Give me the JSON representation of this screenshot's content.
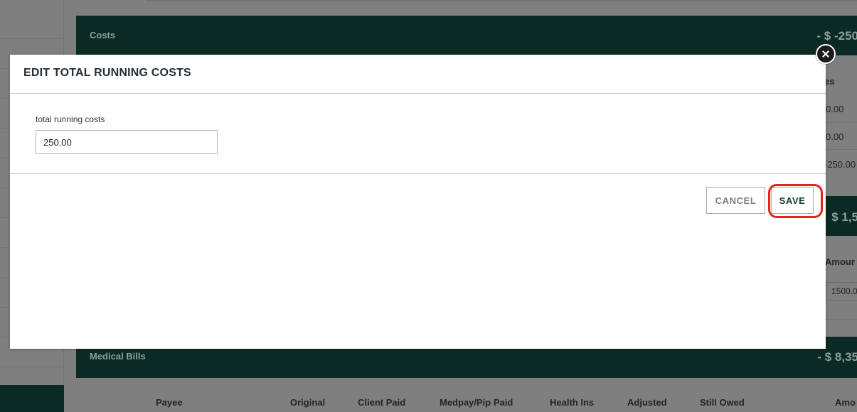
{
  "background": {
    "costs_band": {
      "title": "Costs",
      "amount": "- $ -250"
    },
    "mid_band": {
      "amount": "$ 1,5"
    },
    "medical_band": {
      "title": "Medical Bills",
      "amount": "- $ 8,35"
    },
    "costs_peek": {
      "header": "es",
      "row1": "0.00",
      "row2": "0.00",
      "row3": "-250.00"
    },
    "mid_peek": {
      "header": "Amour",
      "row1": "1500.0"
    },
    "medical_table_headers": [
      "Payee",
      "Original",
      "Client Paid",
      "Medpay/Pip Paid",
      "Health Ins",
      "Adjusted",
      "Still Owed",
      "Amo"
    ]
  },
  "modal": {
    "title": "EDIT TOTAL RUNNING COSTS",
    "field_label": "total running costs",
    "field_value": "250.00",
    "cancel_label": "CANCEL",
    "save_label": "SAVE"
  },
  "colors": {
    "band_dark_green": "#0b2a24",
    "overlay_gray": "#7f7f7f",
    "highlight_red": "#e4241c",
    "save_text": "#0c3a32"
  },
  "icons": {
    "close": "close-icon"
  }
}
